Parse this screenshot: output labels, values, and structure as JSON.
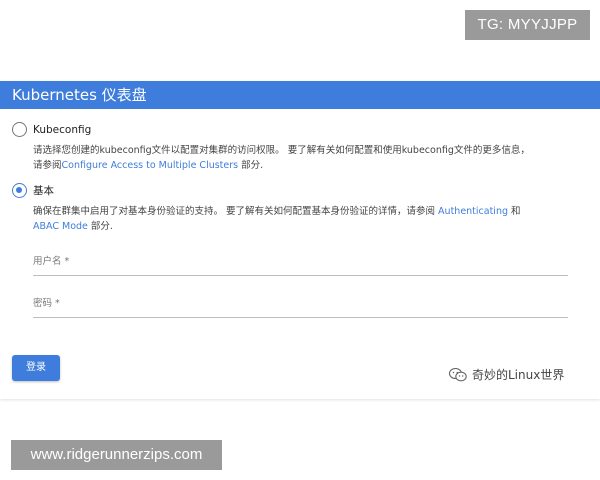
{
  "watermarks": {
    "tg": "TG: MYYJJPP",
    "url": "www.ridgerunnerzips.com",
    "wechat": "奇妙的Linux世界"
  },
  "header": {
    "title": "Kubernetes 仪表盘"
  },
  "options": {
    "kubeconfig": {
      "label": "Kubeconfig",
      "selected": false,
      "desc_line1": "请选择您创建的kubeconfig文件以配置对集群的访问权限。 要了解有关如何配置和使用kubeconfig文件的更多信息，",
      "desc_pre": "请参阅",
      "desc_link": "Configure Access to Multiple Clusters",
      "desc_post": " 部分."
    },
    "basic": {
      "label": "基本",
      "selected": true,
      "desc_line1_pre": "确保在群集中启用了对基本身份验证的支持。 要了解有关如何配置基本身份验证的详情，请参阅 ",
      "desc_link1": "Authenticating",
      "desc_and": " 和",
      "desc_link2": "ABAC Mode",
      "desc_post": " 部分."
    }
  },
  "form": {
    "username_placeholder": "用户名 *",
    "password_placeholder": "密码 *"
  },
  "actions": {
    "login_label": "登录"
  },
  "colors": {
    "accent": "#3f7ddc",
    "watermark_bg": "#9a9a9a"
  }
}
